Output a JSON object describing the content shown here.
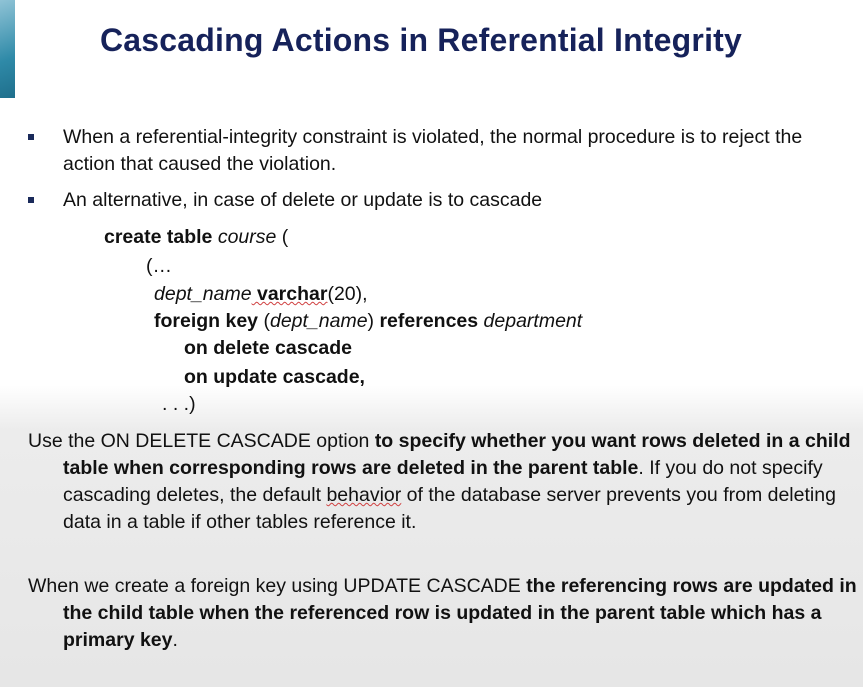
{
  "slide": {
    "title": "Cascading Actions in Referential Integrity",
    "bullets": [
      "When a referential-integrity constraint is violated, the normal procedure is to reject the action that caused the violation.",
      "An alternative, in case of delete or update is to cascade"
    ],
    "code": {
      "l1a": "create table",
      "l1b": " course ",
      "l1c": "(",
      "l2": "(…",
      "l3a": "dept_name",
      "l3b": " varchar",
      "l3c": "(20),",
      "l4a": "foreign key",
      "l4b": " (",
      "l4c": "dept_name",
      "l4d": ") ",
      "l4e": "references",
      "l4f": " department",
      "l5": "on delete cascade",
      "l6": "on update cascade,",
      "l7": ". . .)"
    },
    "para1": {
      "a": "Use the ON DELETE CASCADE option ",
      "b": "to specify whether you want rows deleted in a child table when corresponding rows are deleted in the parent table",
      "c": ". If you do not specify cascading deletes, the default ",
      "d": "behavior",
      "e": " of the database server prevents you from deleting data in a table if other tables reference it."
    },
    "para2": {
      "a": "When we create a foreign key using UPDATE CASCADE ",
      "b": "the referencing rows are updated in the child table when the referenced row is updated in the parent table which has a primary key",
      "c": "."
    }
  }
}
